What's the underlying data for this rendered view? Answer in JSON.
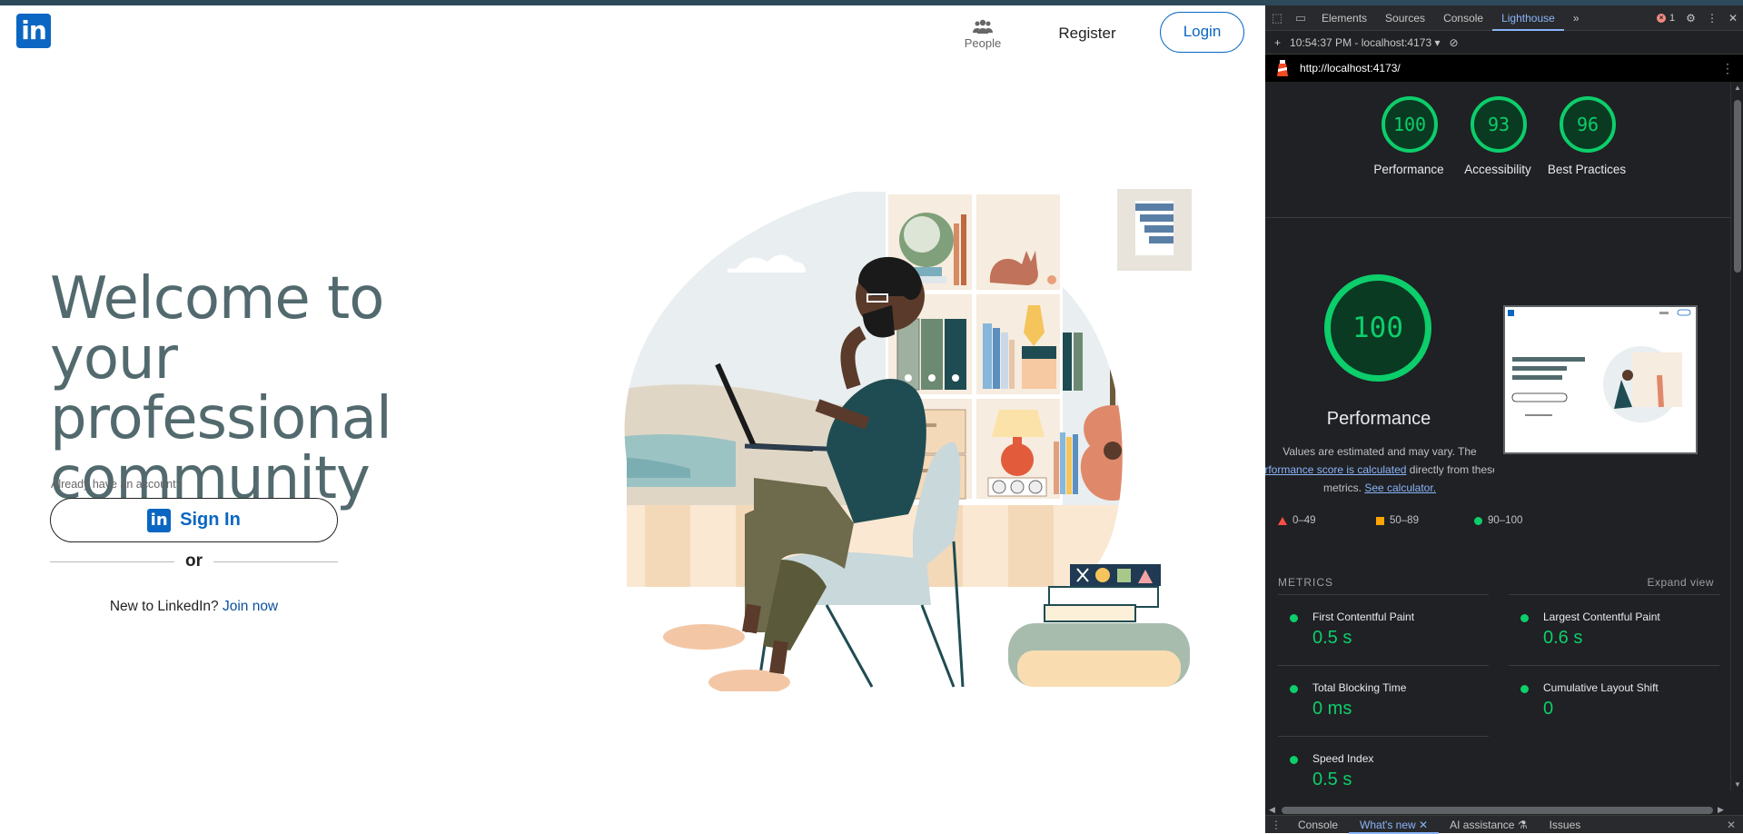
{
  "page": {
    "logo_text": "in",
    "nav": {
      "people": "People",
      "register": "Register",
      "login": "Login"
    },
    "hero_title": "Welcome to your professional community",
    "already": "Already have an account?",
    "signin_logo": "in",
    "signin_label": "Sign In",
    "or": "or",
    "new_text": "New to LinkedIn?",
    "join": "Join now"
  },
  "devtools": {
    "tabs": [
      "Elements",
      "Sources",
      "Console",
      "Lighthouse"
    ],
    "active_tab": "Lighthouse",
    "more": "»",
    "error_count": "1",
    "timestamp": "10:54:37 PM - localhost:4173 ▾",
    "url": "http://localhost:4173/",
    "scores": [
      {
        "value": "100",
        "label": "Performance"
      },
      {
        "value": "93",
        "label": "Accessibility"
      },
      {
        "value": "96",
        "label": "Best Practices"
      }
    ],
    "perf_score": "100",
    "perf_title": "Performance",
    "desc_1": "Values are estimated and may vary. The",
    "desc_link": "performance score is calculated",
    "desc_2": "directly from these",
    "desc_3": "metrics.",
    "desc_link2": "See calculator.",
    "legend": [
      "0–49",
      "50–89",
      "90–100"
    ],
    "metrics_title": "METRICS",
    "expand": "Expand view",
    "metrics": [
      {
        "name": "First Contentful Paint",
        "value": "0.5 s"
      },
      {
        "name": "Largest Contentful Paint",
        "value": "0.6 s"
      },
      {
        "name": "Total Blocking Time",
        "value": "0 ms"
      },
      {
        "name": "Cumulative Layout Shift",
        "value": "0"
      },
      {
        "name": "Speed Index",
        "value": "0.5 s"
      }
    ],
    "drawer_tabs": [
      "Console",
      "What's new",
      "AI assistance",
      "Issues"
    ],
    "drawer_active": "What's new"
  },
  "colors": {
    "brand": "#0a66c2",
    "pass": "#0cce6b",
    "average": "#ffa400",
    "fail": "#ff4e42"
  }
}
